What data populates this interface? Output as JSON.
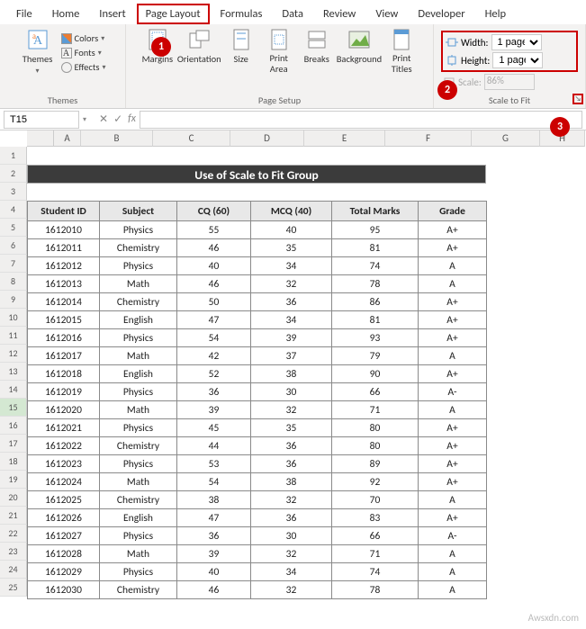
{
  "ribbon": {
    "tabs": [
      "File",
      "Home",
      "Insert",
      "Page Layout",
      "Formulas",
      "Data",
      "Review",
      "View",
      "Developer",
      "Help"
    ],
    "active_tab": 3,
    "groups": {
      "themes": {
        "label": "Themes",
        "themes_btn": "Themes",
        "colors": "Colors",
        "fonts": "Fonts",
        "effects": "Effects"
      },
      "page_setup": {
        "label": "Page Setup",
        "margins": "Margins",
        "orientation": "Orientation",
        "size": "Size",
        "print_area": "Print\nArea",
        "breaks": "Breaks",
        "background": "Background",
        "print_titles": "Print\nTitles"
      },
      "scale": {
        "label": "Scale to Fit",
        "width_label": "Width:",
        "height_label": "Height:",
        "scale_label": "Scale:",
        "width_val": "1 page",
        "height_val": "1 page",
        "scale_val": "86%"
      }
    }
  },
  "callouts": {
    "one": "1",
    "two": "2",
    "three": "3"
  },
  "namebox": "T15",
  "fx_label": "fx",
  "columns": [
    "A",
    "B",
    "C",
    "D",
    "E",
    "F",
    "G",
    "H"
  ],
  "row_count": 25,
  "selected_row": 15,
  "title": "Use of Scale to Fit Group",
  "headers": [
    "Student ID",
    "Subject",
    "CQ  (60)",
    "MCQ  (40)",
    "Total Marks",
    "Grade"
  ],
  "rows": [
    [
      "1612010",
      "Physics",
      "55",
      "40",
      "95",
      "A+"
    ],
    [
      "1612011",
      "Chemistry",
      "46",
      "35",
      "81",
      "A+"
    ],
    [
      "1612012",
      "Physics",
      "40",
      "34",
      "74",
      "A"
    ],
    [
      "1612013",
      "Math",
      "46",
      "32",
      "78",
      "A"
    ],
    [
      "1612014",
      "Chemistry",
      "50",
      "36",
      "86",
      "A+"
    ],
    [
      "1612015",
      "English",
      "47",
      "34",
      "81",
      "A+"
    ],
    [
      "1612016",
      "Physics",
      "54",
      "39",
      "93",
      "A+"
    ],
    [
      "1612017",
      "Math",
      "42",
      "37",
      "79",
      "A"
    ],
    [
      "1612018",
      "English",
      "52",
      "38",
      "90",
      "A+"
    ],
    [
      "1612019",
      "Physics",
      "36",
      "30",
      "66",
      "A-"
    ],
    [
      "1612020",
      "Math",
      "39",
      "32",
      "71",
      "A"
    ],
    [
      "1612021",
      "Physics",
      "45",
      "35",
      "80",
      "A+"
    ],
    [
      "1612022",
      "Chemistry",
      "44",
      "36",
      "80",
      "A+"
    ],
    [
      "1612023",
      "Physics",
      "53",
      "36",
      "89",
      "A+"
    ],
    [
      "1612024",
      "Math",
      "54",
      "38",
      "92",
      "A+"
    ],
    [
      "1612025",
      "Chemistry",
      "38",
      "32",
      "70",
      "A"
    ],
    [
      "1612026",
      "English",
      "47",
      "36",
      "83",
      "A+"
    ],
    [
      "1612027",
      "Physics",
      "36",
      "30",
      "66",
      "A-"
    ],
    [
      "1612028",
      "Math",
      "39",
      "32",
      "71",
      "A"
    ],
    [
      "1612029",
      "Physics",
      "40",
      "34",
      "74",
      "A"
    ],
    [
      "1612030",
      "Chemistry",
      "46",
      "32",
      "78",
      "A"
    ]
  ],
  "watermark": "Awsxdn.com"
}
